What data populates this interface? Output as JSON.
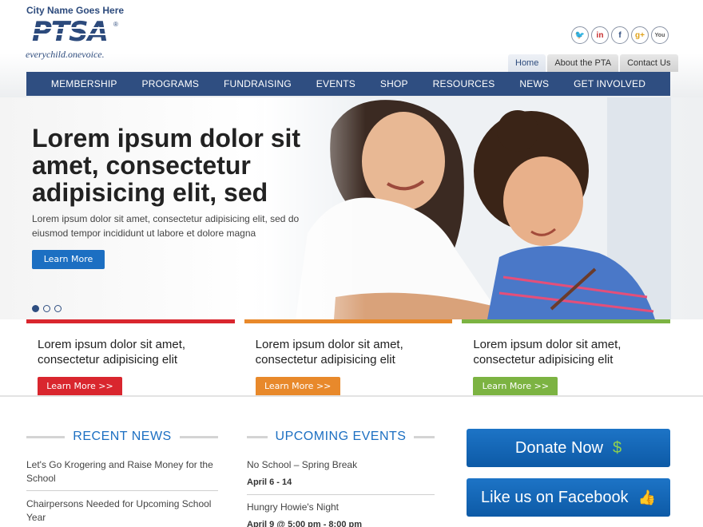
{
  "header": {
    "city_name": "City Name Goes Here",
    "logo_text": "PTSA",
    "tagline_a": "everychild.",
    "tagline_b": "onevoice.",
    "social": [
      {
        "name": "twitter-icon",
        "glyph": "🐦",
        "color": "#2c4a7c"
      },
      {
        "name": "linkedin-icon",
        "glyph": "in",
        "color": "#c62a2a"
      },
      {
        "name": "facebook-icon",
        "glyph": "f",
        "color": "#2c4a7c"
      },
      {
        "name": "googleplus-icon",
        "glyph": "g+",
        "color": "#e0a21a"
      },
      {
        "name": "youtube-icon",
        "glyph": "You",
        "color": "#555555"
      }
    ],
    "util_tabs": [
      "Home",
      "About the PTA",
      "Contact Us"
    ]
  },
  "nav": {
    "items": [
      "MEMBERSHIP",
      "PROGRAMS",
      "FUNDRAISING",
      "EVENTS",
      "SHOP",
      "RESOURCES",
      "NEWS",
      "GET INVOLVED"
    ]
  },
  "hero": {
    "title": "Lorem ipsum dolor sit amet, consectetur adipisicing elit, sed",
    "text": "Lorem ipsum dolor sit amet, consectetur adipisicing elit, sed do eiusmod tempor incididunt ut labore et dolore magna",
    "button": "Learn More"
  },
  "cards": [
    {
      "title": "Lorem ipsum dolor sit amet, consectetur adipisicing elit",
      "button": "Learn More >>",
      "color": "#d9262e"
    },
    {
      "title": "Lorem ipsum dolor sit amet, consectetur adipisicing elit",
      "button": "Learn More >>",
      "color": "#e8892b"
    },
    {
      "title": "Lorem ipsum dolor sit amet, consectetur adipisicing elit",
      "button": "Learn More >>",
      "color": "#7cb342"
    }
  ],
  "news": {
    "heading": "RECENT NEWS",
    "items": [
      "Let's Go Krogering and Raise Money for the School",
      "Chairpersons Needed for Upcoming School Year"
    ]
  },
  "events": {
    "heading": "UPCOMING EVENTS",
    "items": [
      {
        "title": "No School – Spring Break",
        "date": "April 6 - 14"
      },
      {
        "title": "Hungry Howie's Night",
        "date": "April 9 @ 5:00 pm - 8:00 pm"
      }
    ]
  },
  "actions": {
    "donate": "Donate Now",
    "donate_glyph": "$",
    "facebook": "Like us on Facebook",
    "facebook_glyph": "👍"
  }
}
